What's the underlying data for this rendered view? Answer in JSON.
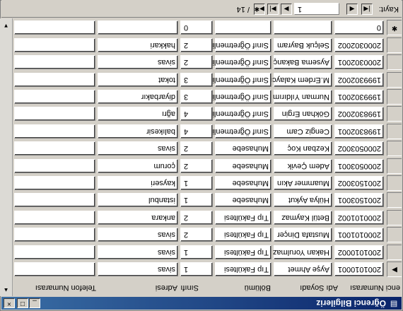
{
  "window": {
    "title": "Öğrenci Bilgileriz",
    "minimize_glyph": "_",
    "maximize_glyph": "□",
    "close_glyph": "×"
  },
  "columns": {
    "student_no": "enci Numarası",
    "name": "Adı Soyadı",
    "department": "Bölümü",
    "class": "Sınıfı",
    "address": "Adresi",
    "phone": "Telefon Numarası"
  },
  "records": [
    {
      "student_no": "2001010001",
      "name": "Ayşe Ahmet",
      "department": "Tıp Fakültesi",
      "class": "1",
      "address": "sivas",
      "phone": "",
      "selector": "▶"
    },
    {
      "student_no": "2001010002",
      "name": "Hakan Yorulmaz",
      "department": "Tıp Fakültesi",
      "class": "1",
      "address": "sivas",
      "phone": "",
      "selector": ""
    },
    {
      "student_no": "2000101001",
      "name": "Mustafa Dinçer",
      "department": "Tıp Fakültesi",
      "class": "2",
      "address": "sivas",
      "phone": "",
      "selector": ""
    },
    {
      "student_no": "2000101002",
      "name": "Betül Kaymaz",
      "department": "Tıp Fakültesi",
      "class": "2",
      "address": "ankara",
      "phone": "",
      "selector": ""
    },
    {
      "student_no": "2001503001",
      "name": "Hülya Aykut",
      "department": "Muhasebe",
      "class": "1",
      "address": "istanbul",
      "phone": "",
      "selector": ""
    },
    {
      "student_no": "2001503002",
      "name": "Muammer Akın",
      "department": "Muhasebe",
      "class": "1",
      "address": "kayseri",
      "phone": "",
      "selector": ""
    },
    {
      "student_no": "2000503001",
      "name": "Adem Çevik",
      "department": "Muhasebe",
      "class": "2",
      "address": "çorum",
      "phone": "",
      "selector": ""
    },
    {
      "student_no": "2000503002",
      "name": "Kezban Koç",
      "department": "Muhasebe",
      "class": "2",
      "address": "sivas",
      "phone": "",
      "selector": ""
    },
    {
      "student_no": "1998302001",
      "name": "Cengiz Cam",
      "department": "Sınıf Öğretmenliği",
      "class": "4",
      "address": "balıkesir",
      "phone": "",
      "selector": ""
    },
    {
      "student_no": "1998302002",
      "name": "Gökhan Ergin",
      "department": "Sınıf Öğretmenliği",
      "class": "4",
      "address": "ağrı",
      "phone": "",
      "selector": ""
    },
    {
      "student_no": "1999302001",
      "name": "Nurman Yıldırım",
      "department": "Sınıf Öğretmenliği",
      "class": "3",
      "address": "diyarbakır",
      "phone": "",
      "selector": ""
    },
    {
      "student_no": "1999302002",
      "name": "M.Erdem Kalaycı",
      "department": "Sınıf Öğretmenliği",
      "class": "3",
      "address": "tokat",
      "phone": "",
      "selector": ""
    },
    {
      "student_no": "2000302001",
      "name": "Aysema Bakanç",
      "department": "Sınıf Öğretmenliği",
      "class": "2",
      "address": "sivas",
      "phone": "",
      "selector": ""
    },
    {
      "student_no": "2000302002",
      "name": "Selçuk Bayram",
      "department": "Sınıf Öğretmenliği",
      "class": "2",
      "address": "hakkari",
      "phone": "",
      "selector": ""
    }
  ],
  "new_record": {
    "student_no": "0",
    "name": "",
    "department": "",
    "class": "0",
    "address": "",
    "phone": "",
    "selector": "✱"
  },
  "navigator": {
    "label": "Kayıt:",
    "current": "1",
    "of_label": "/ 14",
    "first_glyph": "|◀",
    "prev_glyph": "◀",
    "next_glyph": "▶",
    "last_glyph": "▶|",
    "new_glyph": "▶✱"
  },
  "scrollbar": {
    "up_glyph": "▲",
    "down_glyph": "▼"
  }
}
